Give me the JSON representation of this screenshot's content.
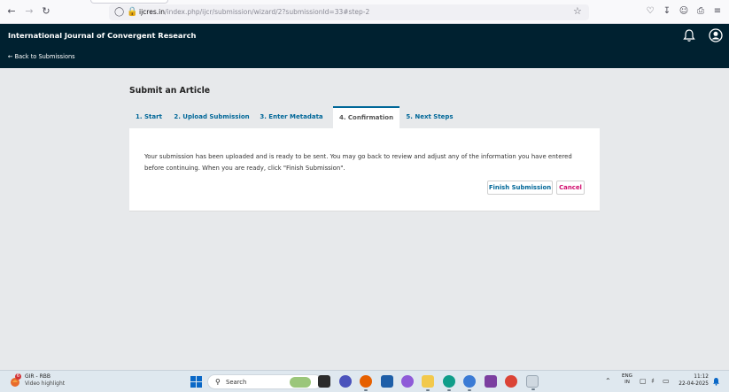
{
  "browser": {
    "url_domain": "ijcres.in",
    "url_path": "/index.php/ijcr/submission/wizard/2?submissionId=33#step-2"
  },
  "header": {
    "site_title": "International Journal of Convergent Research",
    "back_link": "← Back to Submissions"
  },
  "main": {
    "page_title": "Submit an Article",
    "tabs": [
      {
        "label": "1. Start",
        "active": false
      },
      {
        "label": "2. Upload Submission",
        "active": false
      },
      {
        "label": "3. Enter Metadata",
        "active": false
      },
      {
        "label": "4. Confirmation",
        "active": true
      },
      {
        "label": "5. Next Steps",
        "active": false
      }
    ],
    "message": "Your submission has been uploaded and is ready to be sent. You may go back to review and adjust any of the information you have entered before continuing. When you are ready, click \"Finish Submission\".",
    "finish_label": "Finish Submission",
    "cancel_label": "Cancel"
  },
  "taskbar": {
    "weather_badge": "6",
    "news_title": "GIR - RBB",
    "news_subtitle": "Video highlight",
    "search_placeholder": "Search",
    "lang_primary": "ENG",
    "lang_secondary": "IN",
    "time": "11:12",
    "date": "22-04-2025"
  },
  "colors": {
    "header_bg": "#002130",
    "link": "#006798",
    "cancel": "#d00a6c",
    "page_bg": "#e7e9eb"
  }
}
